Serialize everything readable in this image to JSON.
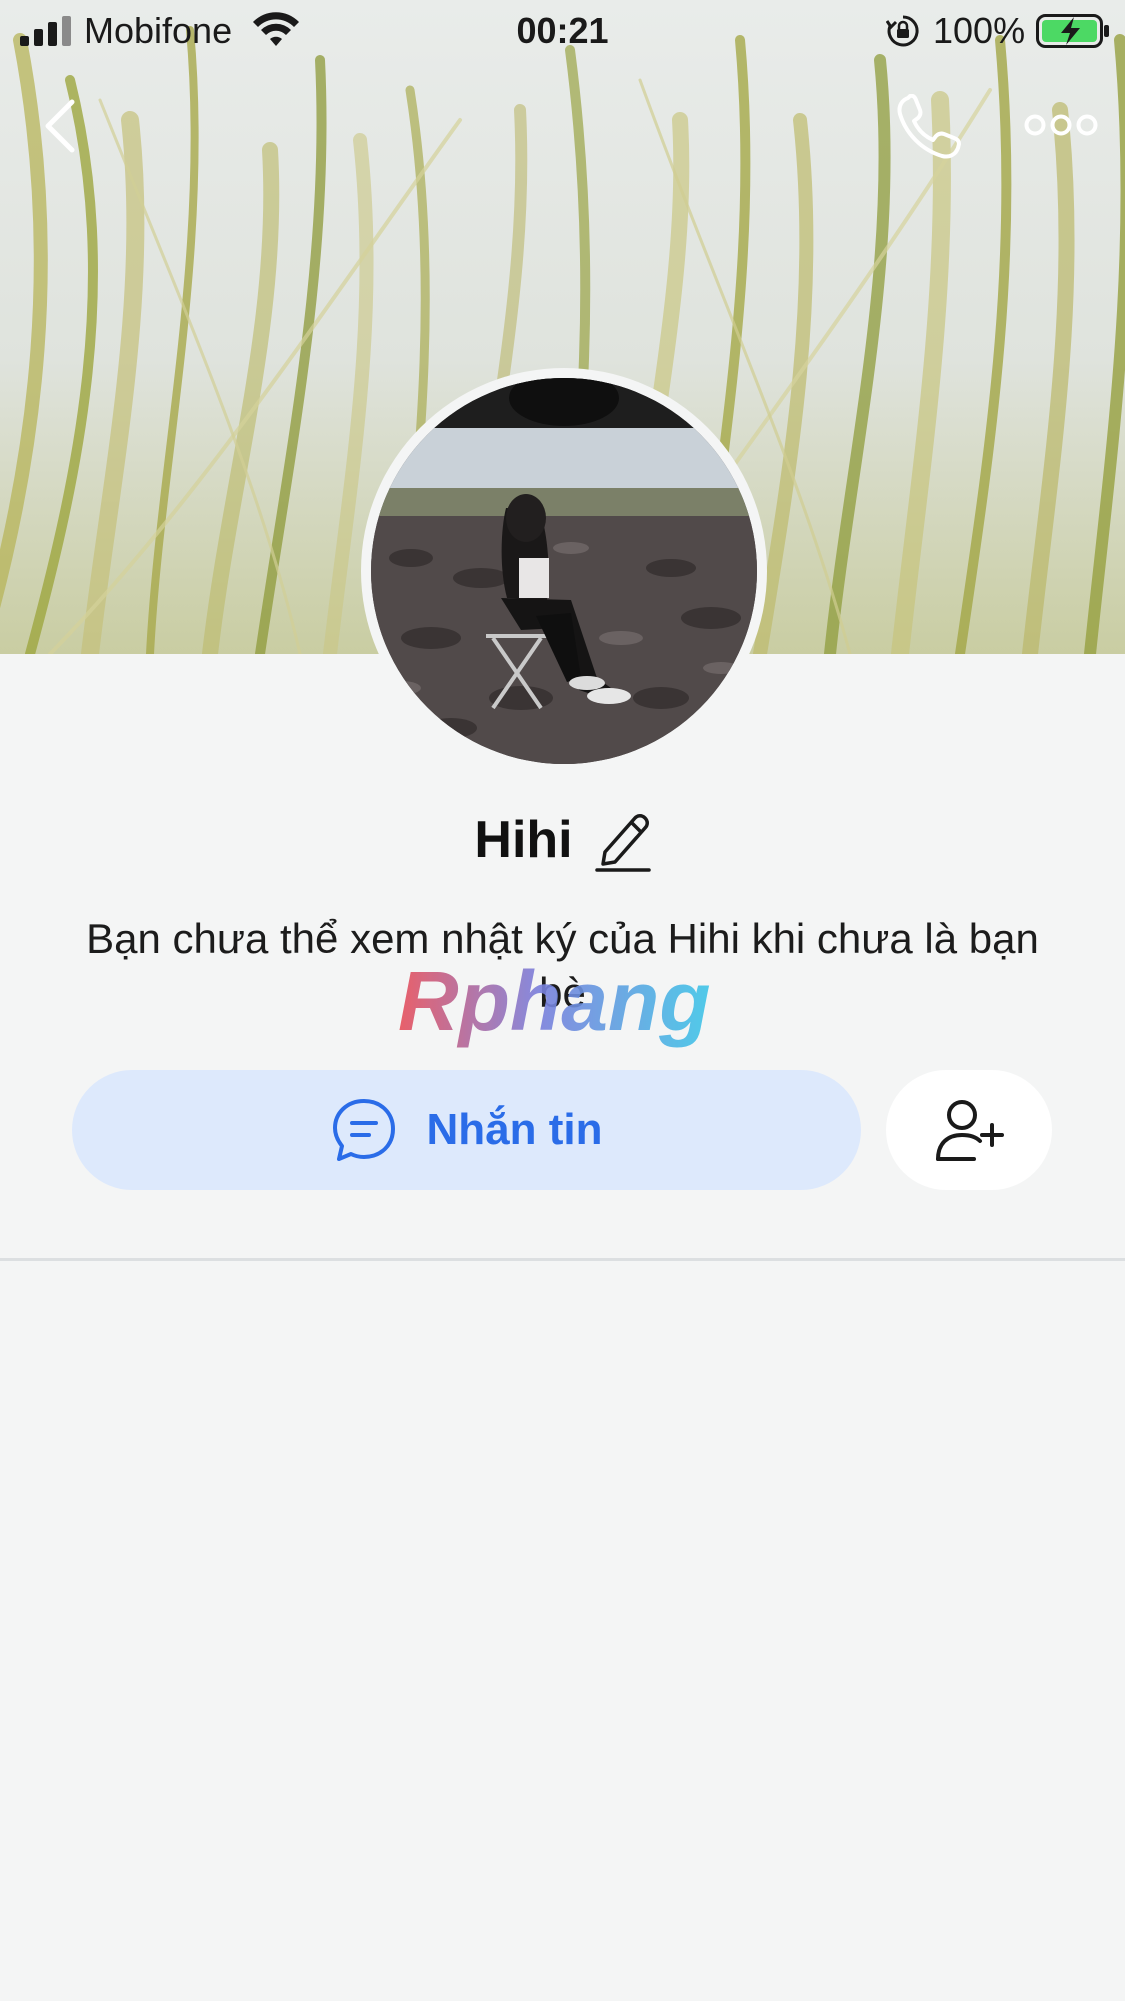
{
  "status_bar": {
    "carrier": "Mobifone",
    "time": "00:21",
    "battery_percent": "100%"
  },
  "header": {
    "back_icon": "chevron-left-icon",
    "call_icon": "phone-icon",
    "more_icon": "more-horizontal-icon"
  },
  "profile": {
    "name": "Hihi",
    "edit_icon": "pencil-icon",
    "privacy_note": "Bạn chưa thể xem nhật ký của Hihi khi chưa là bạn bè"
  },
  "actions": {
    "message_label": "Nhắn tin",
    "message_icon": "chat-bubble-icon",
    "add_friend_icon": "add-user-icon"
  },
  "watermark": {
    "text": "Rphang"
  },
  "colors": {
    "accent": "#2a6ce8",
    "message_button_bg": "#dde9fc",
    "page_bg": "#f4f5f5"
  }
}
